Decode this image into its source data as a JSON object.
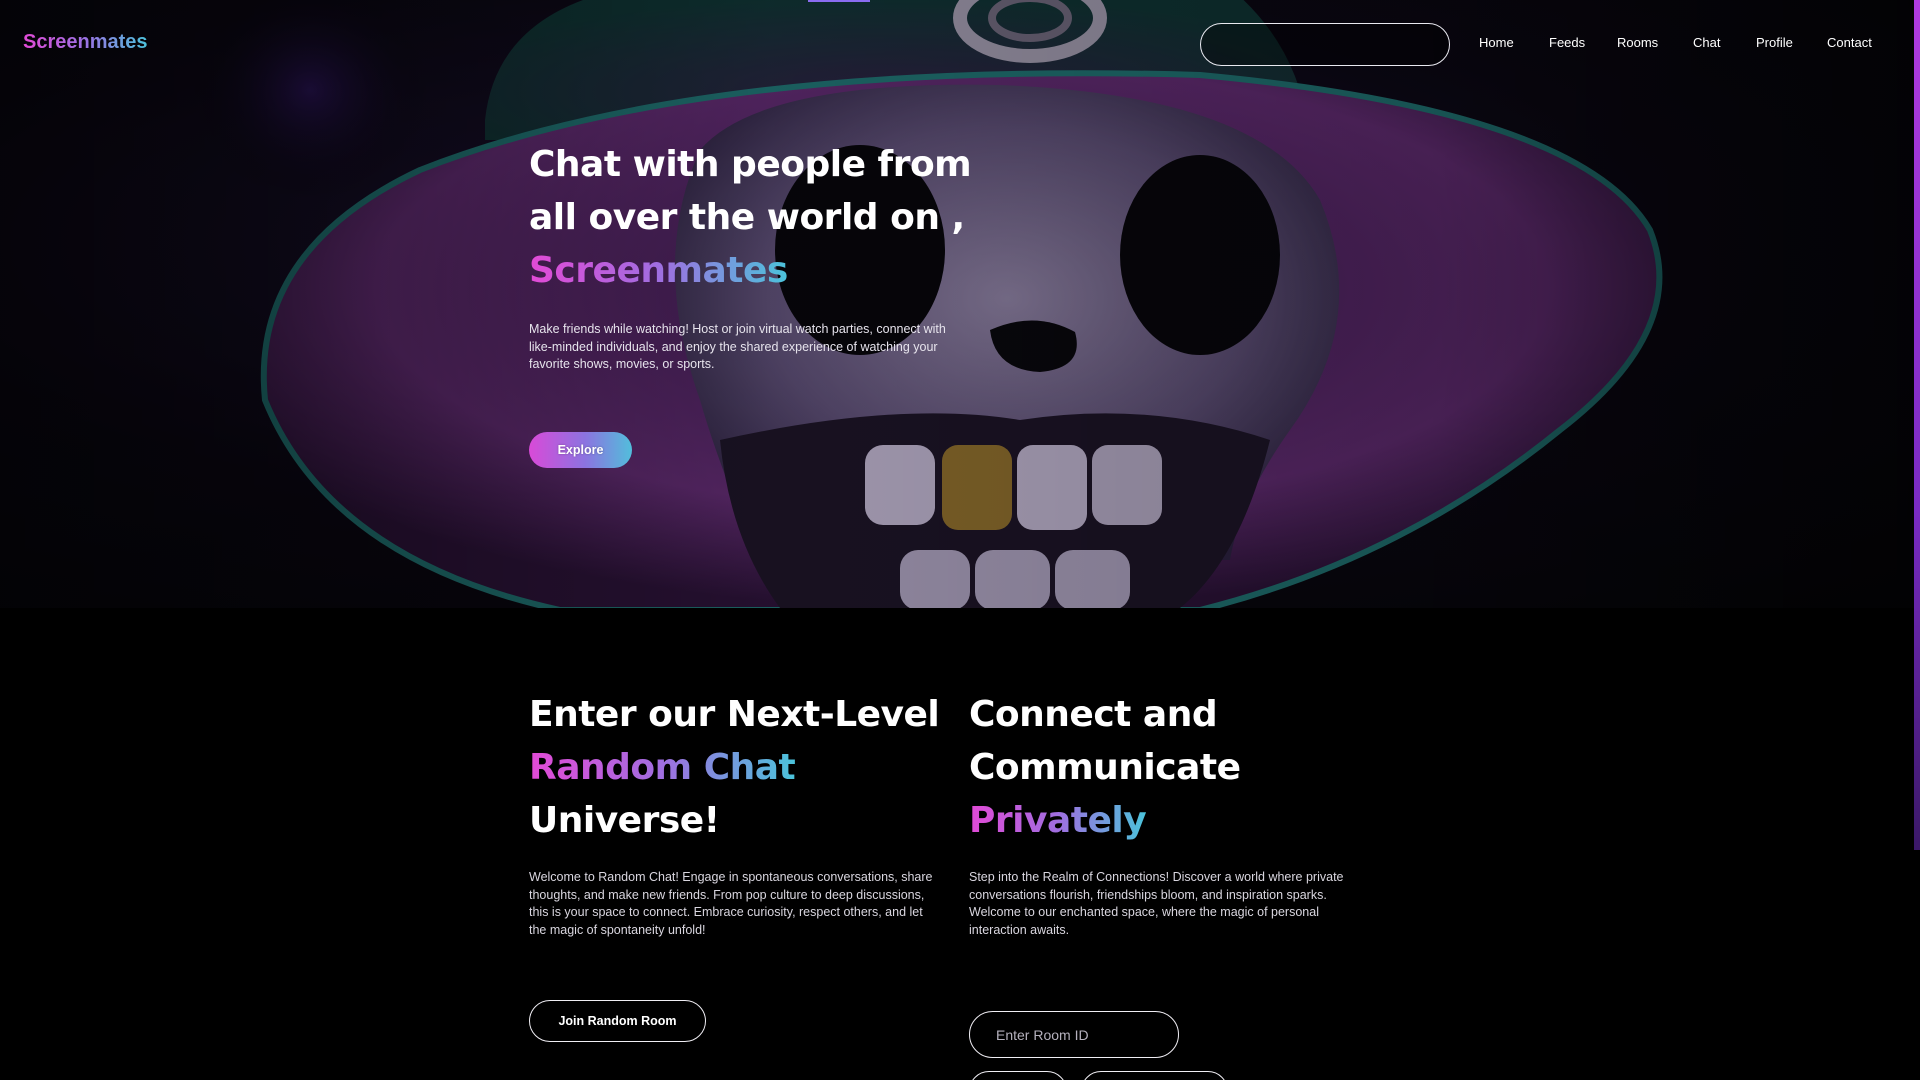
{
  "brand": {
    "name": "Screenmates"
  },
  "search": {
    "placeholder": "",
    "icon": "search-icon"
  },
  "nav": {
    "items": [
      {
        "label": "Home"
      },
      {
        "label": "Feeds"
      },
      {
        "label": "Rooms"
      },
      {
        "label": "Chat"
      },
      {
        "label": "Profile"
      },
      {
        "label": "Contact"
      }
    ]
  },
  "hero": {
    "title_line1": "Chat with people from",
    "title_line2": "all over the world on ,",
    "title_highlight": "Screenmates",
    "description": "Make friends while watching! Host or join virtual watch parties, connect with like-minded individuals, and enjoy the shared experience of watching your favorite shows, movies, or sports.",
    "cta_label": "Explore"
  },
  "random_chat": {
    "title_line1": "Enter our Next-Level",
    "title_highlight": "Random Chat",
    "title_line3": "Universe!",
    "description": "Welcome to Random Chat! Engage in spontaneous conversations, share thoughts, and make new friends. From pop culture to deep discussions, this is your space to connect. Embrace curiosity, respect others, and let the magic of spontaneity unfold!",
    "button_label": "Join Random Room"
  },
  "private_chat": {
    "title_line1": "Connect and",
    "title_line2": "Communicate",
    "title_highlight": "Privately",
    "description": "Step into the Realm of Connections! Discover a world where private conversations flourish, friendships bloom, and inspiration sparks. Welcome to our enchanted space, where the magic of personal interaction awaits.",
    "room_input_placeholder": "Enter Room ID"
  },
  "colors": {
    "gradient_start": "#e24ad6",
    "gradient_mid": "#a06ee0",
    "gradient_end": "#4bc3db",
    "background": "#000000"
  }
}
